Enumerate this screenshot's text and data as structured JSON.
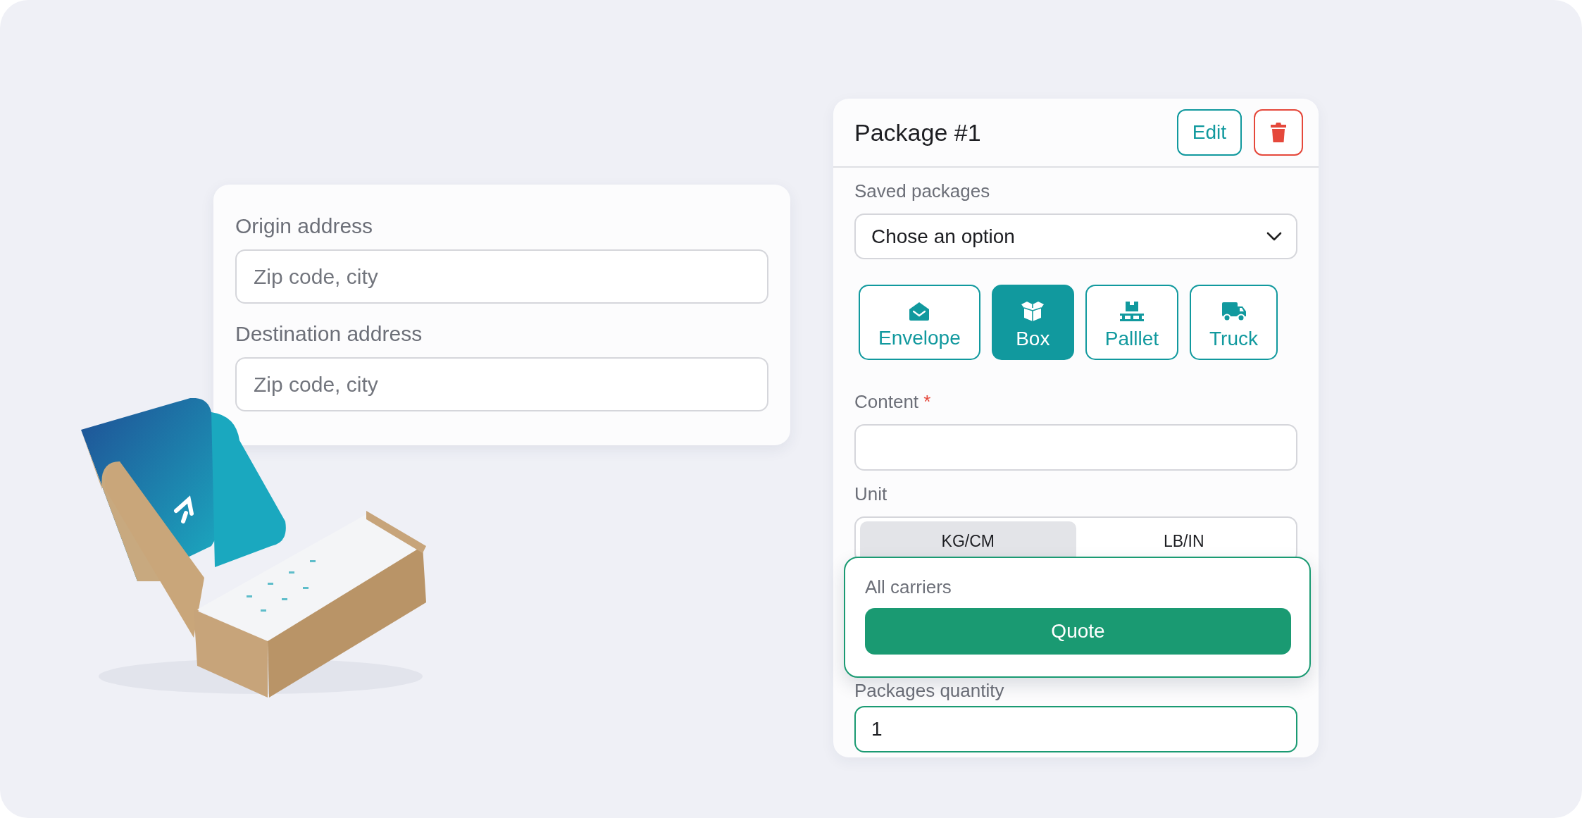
{
  "address_form": {
    "fields": [
      {
        "label": "Origin address",
        "placeholder": "Zip code, city"
      },
      {
        "label": "Destination address",
        "placeholder": "Zip code, city"
      }
    ]
  },
  "package": {
    "title": "Package #1",
    "edit_button": "Edit",
    "saved_packages": {
      "label": "Saved packages",
      "value": "Chose an option"
    },
    "types": [
      {
        "label": "Envelope",
        "kind": "envelope",
        "selected": false
      },
      {
        "label": "Box",
        "kind": "box",
        "selected": true
      },
      {
        "label": "Palllet",
        "kind": "pallet",
        "selected": false
      },
      {
        "label": "Truck",
        "kind": "truck",
        "selected": false
      }
    ],
    "content": {
      "label": "Content",
      "required_mark": "*"
    },
    "unit": {
      "label": "Unit",
      "options": [
        {
          "label": "KG/CM",
          "selected": true
        },
        {
          "label": "LB/IN",
          "selected": false
        }
      ]
    },
    "quantity": {
      "label": "Packages quantity",
      "value": "1"
    }
  },
  "quote_popup": {
    "label": "All carriers",
    "button": "Quote"
  }
}
